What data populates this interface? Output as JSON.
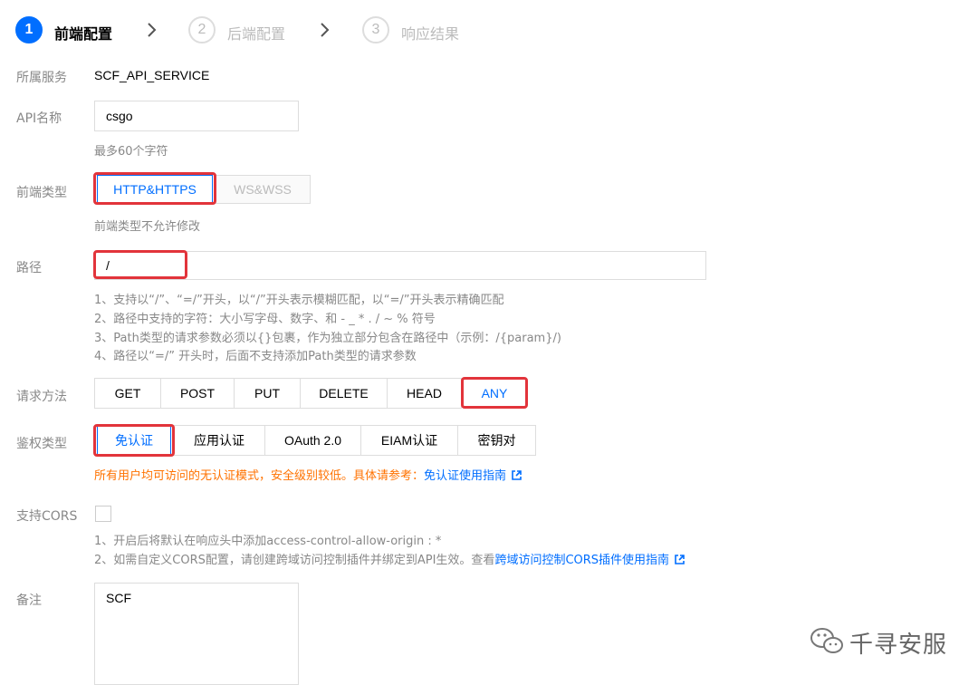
{
  "steps": [
    {
      "number": "1",
      "label": "前端配置"
    },
    {
      "number": "2",
      "label": "后端配置"
    },
    {
      "number": "3",
      "label": "响应结果"
    }
  ],
  "service": {
    "label": "所属服务",
    "value": "SCF_API_SERVICE"
  },
  "api_name": {
    "label": "API名称",
    "value": "csgo",
    "hint": "最多60个字符"
  },
  "frontend_type": {
    "label": "前端类型",
    "options": [
      "HTTP&HTTPS",
      "WS&WSS"
    ],
    "selected": "HTTP&HTTPS",
    "hint": "前端类型不允许修改"
  },
  "path": {
    "label": "路径",
    "value": "/",
    "hints": [
      "1、支持以“/”、“=/”开头，以“/”开头表示模糊匹配，以“=/”开头表示精确匹配",
      "2、路径中支持的字符：大小写字母、数字、和 - _ * . / ~ % 符号",
      "3、Path类型的请求参数必须以{}包裹，作为独立部分包含在路径中（示例：/{param}/)",
      "4、路径以“=/” 开头时，后面不支持添加Path类型的请求参数"
    ]
  },
  "method": {
    "label": "请求方法",
    "options": [
      "GET",
      "POST",
      "PUT",
      "DELETE",
      "HEAD",
      "ANY"
    ],
    "selected": "ANY"
  },
  "auth": {
    "label": "鉴权类型",
    "options": [
      "免认证",
      "应用认证",
      "OAuth 2.0",
      "EIAM认证",
      "密钥对"
    ],
    "selected": "免认证",
    "warning_text": "所有用户均可访问的无认证模式，安全级别较低。具体请参考：",
    "warning_link": "免认证使用指南"
  },
  "cors": {
    "label": "支持CORS",
    "checked": false,
    "hint1": "1、开启后将默认在响应头中添加access-control-allow-origin : *",
    "hint2_text": "2、如需自定义CORS配置，请创建跨域访问控制插件并绑定到API生效。查看",
    "hint2_link": "跨域访问控制CORS插件使用指南"
  },
  "remark": {
    "label": "备注",
    "value": "SCF"
  },
  "watermark": {
    "text": "千寻安服"
  },
  "colors": {
    "accent": "#006eff",
    "highlight_box": "#e2343b",
    "warning": "#ff7200"
  }
}
